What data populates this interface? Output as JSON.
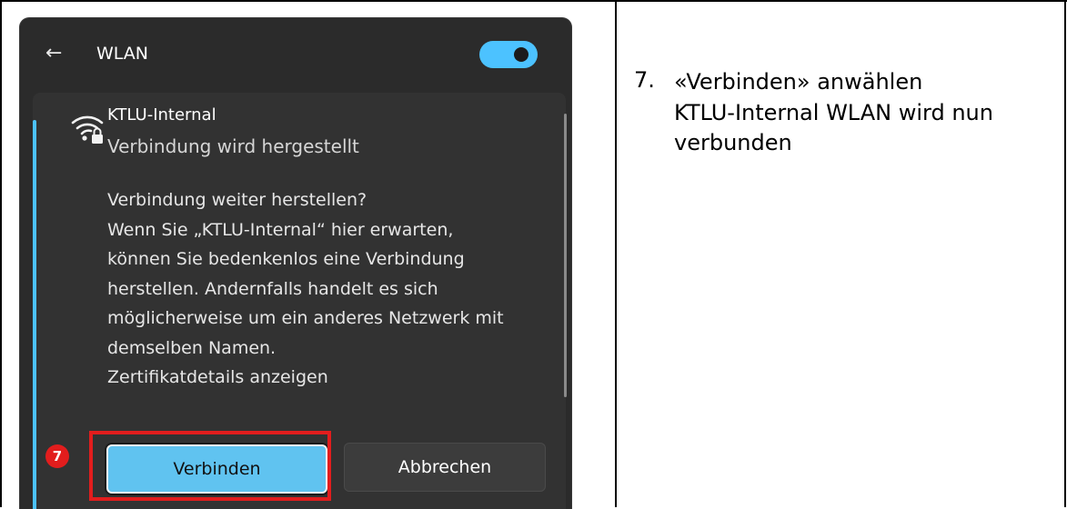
{
  "wlan_panel": {
    "back_icon": "arrow-left-icon",
    "title": "WLAN",
    "toggle_state": "on",
    "accent_color": "#4cc2ff",
    "network": {
      "icon": "wifi-lock-icon",
      "name": "KTLU-Internal",
      "status": "Verbindung wird hergestellt"
    },
    "message_lines": [
      "Verbindung weiter herstellen?",
      "Wenn Sie „KTLU-Internal“ hier erwarten,",
      "können Sie bedenkenlos eine Verbindung",
      "herstellen. Andernfalls handelt es sich",
      "möglicherweise um ein anderes Netzwerk mit",
      "demselben Namen.",
      "Zertifikatdetails anzeigen"
    ],
    "buttons": {
      "connect": "Verbinden",
      "cancel": "Abbrechen"
    }
  },
  "annotation": {
    "step_badge": "7",
    "highlight_color": "#e21d1d"
  },
  "instructions": {
    "number": "7.",
    "lines": [
      "«Verbinden» anwählen",
      "KTLU-Internal WLAN wird nun",
      "verbunden"
    ]
  }
}
